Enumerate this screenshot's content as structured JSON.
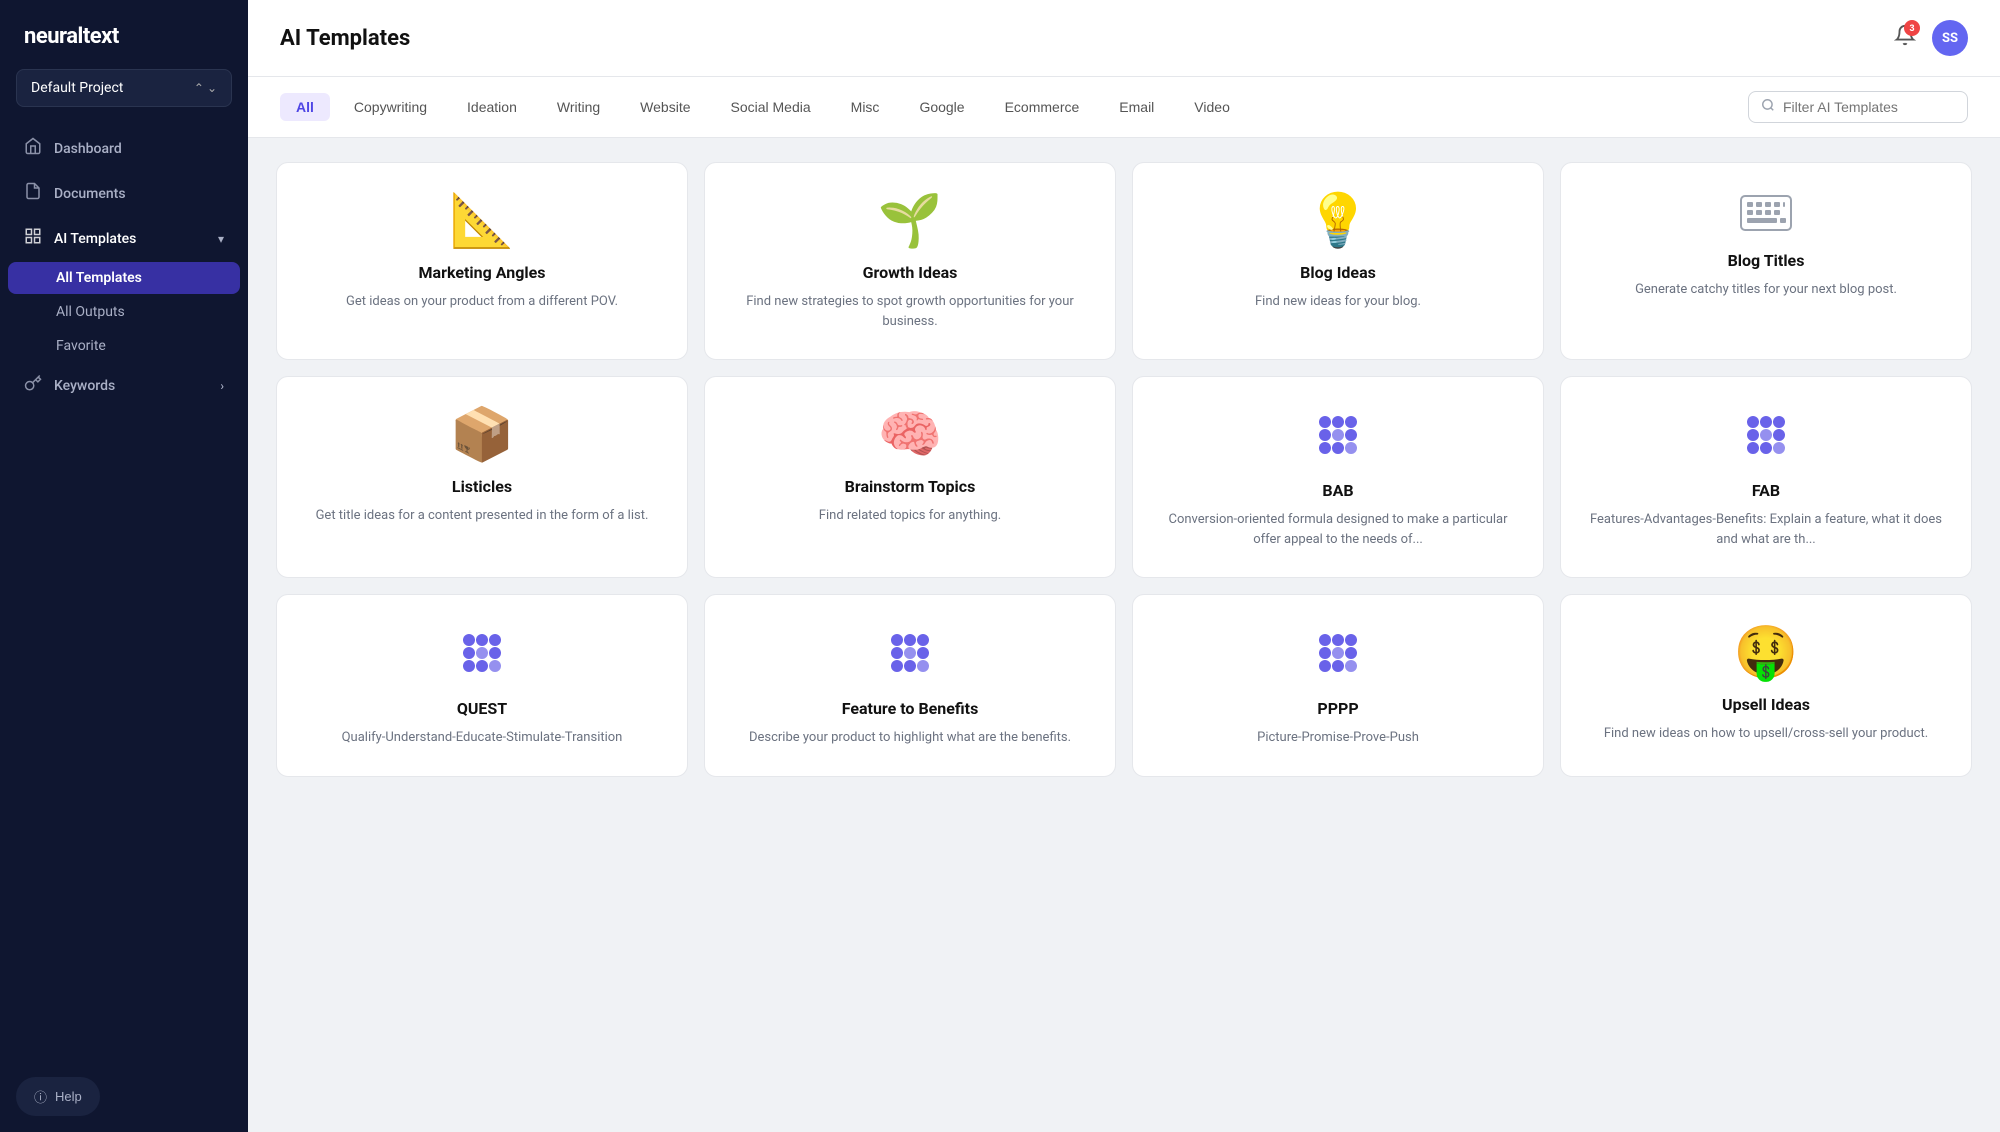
{
  "app": {
    "logo": "neuraltext",
    "project": "Default Project"
  },
  "sidebar": {
    "nav_items": [
      {
        "id": "dashboard",
        "label": "Dashboard",
        "icon": "🏠"
      },
      {
        "id": "documents",
        "label": "Documents",
        "icon": "📄"
      },
      {
        "id": "ai-templates",
        "label": "AI Templates",
        "icon": "▦",
        "active": true,
        "has_arrow": true
      }
    ],
    "sub_items": [
      {
        "id": "all-templates",
        "label": "All Templates",
        "active": true
      },
      {
        "id": "all-outputs",
        "label": "All Outputs",
        "active": false
      },
      {
        "id": "favorite",
        "label": "Favorite",
        "active": false
      }
    ],
    "keywords_item": {
      "label": "Keywords",
      "icon": "🔑"
    },
    "help_label": "Help"
  },
  "header": {
    "title": "AI Templates",
    "notification_count": "3",
    "avatar_initials": "SS"
  },
  "filter_bar": {
    "tabs": [
      {
        "id": "all",
        "label": "All",
        "active": true
      },
      {
        "id": "copywriting",
        "label": "Copywriting",
        "active": false
      },
      {
        "id": "ideation",
        "label": "Ideation",
        "active": false
      },
      {
        "id": "writing",
        "label": "Writing",
        "active": false
      },
      {
        "id": "website",
        "label": "Website",
        "active": false
      },
      {
        "id": "social-media",
        "label": "Social Media",
        "active": false
      },
      {
        "id": "misc",
        "label": "Misc",
        "active": false
      },
      {
        "id": "google",
        "label": "Google",
        "active": false
      },
      {
        "id": "ecommerce",
        "label": "Ecommerce",
        "active": false
      },
      {
        "id": "email",
        "label": "Email",
        "active": false
      },
      {
        "id": "video",
        "label": "Video",
        "active": false
      }
    ],
    "search_placeholder": "Filter AI Templates"
  },
  "cards": [
    {
      "id": "marketing-angles",
      "icon": "📐",
      "title": "Marketing Angles",
      "desc": "Get ideas on your product from a different POV."
    },
    {
      "id": "growth-ideas",
      "icon": "🌱",
      "title": "Growth Ideas",
      "desc": "Find new strategies to spot growth opportunities for your business."
    },
    {
      "id": "blog-ideas",
      "icon": "💡",
      "title": "Blog Ideas",
      "desc": "Find new ideas for your blog."
    },
    {
      "id": "blog-titles",
      "icon": "⌨",
      "title": "Blog Titles",
      "desc": "Generate catchy titles for your next blog post."
    },
    {
      "id": "listicles",
      "icon": "📦",
      "title": "Listicles",
      "desc": "Get title ideas for a content presented in the form of a list."
    },
    {
      "id": "brainstorm-topics",
      "icon": "🧠",
      "title": "Brainstorm Topics",
      "desc": "Find related topics for anything."
    },
    {
      "id": "bab",
      "icon": "dots",
      "title": "BAB",
      "desc": "Conversion-oriented formula designed to make a particular offer appeal to the needs of..."
    },
    {
      "id": "fab",
      "icon": "dots",
      "title": "FAB",
      "desc": "Features-Advantages-Benefits: Explain a feature, what it does and what are th..."
    },
    {
      "id": "quest",
      "icon": "dots",
      "title": "QUEST",
      "desc": "Qualify-Understand-Educate-Stimulate-Transition"
    },
    {
      "id": "feature-to-benefits",
      "icon": "dots",
      "title": "Feature to Benefits",
      "desc": "Describe your product to highlight what are the benefits."
    },
    {
      "id": "pppp",
      "icon": "dots",
      "title": "PPPP",
      "desc": "Picture-Promise-Prove-Push"
    },
    {
      "id": "upsell-ideas",
      "icon": "🤑",
      "title": "Upsell Ideas",
      "desc": "Find new ideas on how to upsell/cross-sell your product."
    }
  ]
}
